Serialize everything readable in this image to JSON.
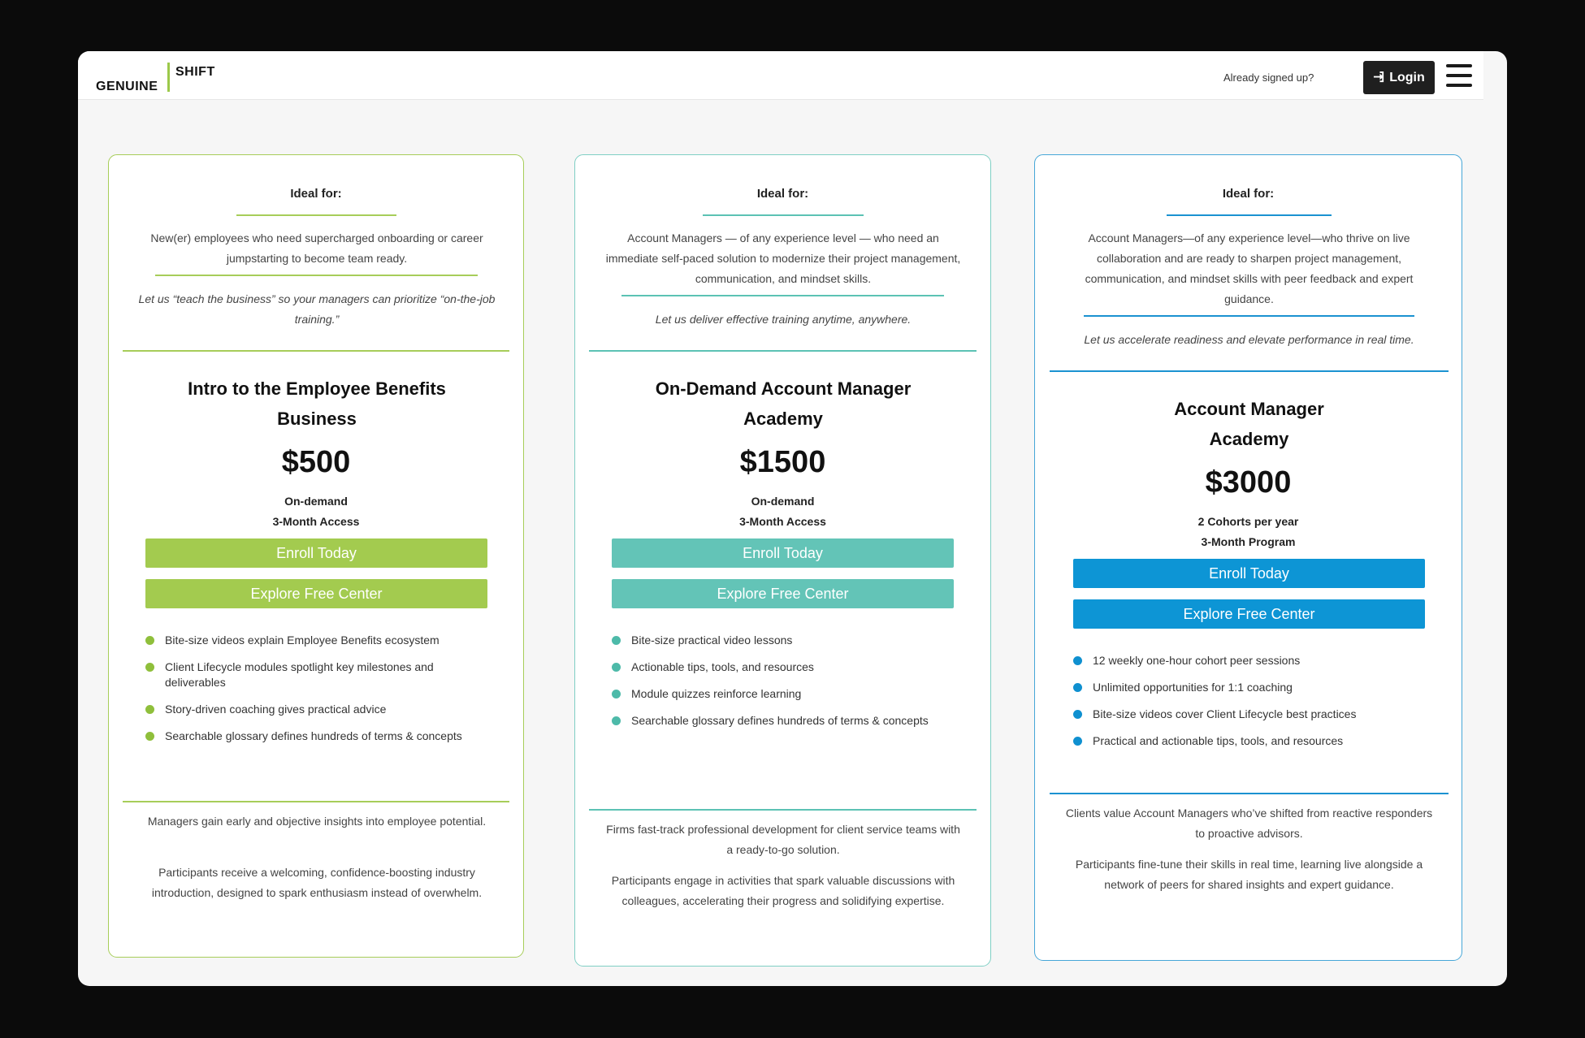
{
  "header": {
    "logo_left": "GENUINE",
    "logo_right": "SHIFT",
    "signed_up_text": "Already signed up?",
    "login_label": "Login",
    "login_icon": "sign-in-icon",
    "menu_icon": "hamburger-menu-icon"
  },
  "colors": {
    "green": "#a3cb4f",
    "teal": "#63c4b7",
    "blue": "#0d95d5",
    "dark": "#1f1f1f"
  },
  "plans": [
    {
      "ideal_label": "Ideal for:",
      "ideal_desc": "New(er) employees who need supercharged onboarding or career jumpstarting to become team ready.",
      "tagline": "Let us “teach the business” so your managers can prioritize “on-the-job training.”",
      "title": "Intro to the Employee Benefits Business",
      "price": "$500",
      "meta_1": "On-demand",
      "meta_2": "3-Month Access",
      "enroll_label": "Enroll Today",
      "explore_label": "Explore Free Center",
      "features": [
        "Bite-size videos explain Employee Benefits ecosystem",
        "Client Lifecycle modules spotlight key milestones and deliverables",
        "Story-driven coaching gives practical advice",
        "Searchable glossary defines hundreds of terms & concepts"
      ],
      "outcome_1": "Managers gain early and objective insights into employee potential.",
      "outcome_2": "Participants receive a welcoming, confidence-boosting industry introduction, designed to spark enthusiasm instead of overwhelm."
    },
    {
      "ideal_label": "Ideal for:",
      "ideal_desc": "Account Managers — of any experience level — who need an immediate self-paced solution to modernize their project management, communication, and mindset skills.",
      "tagline": "Let us deliver effective training anytime, anywhere.",
      "title": "On-Demand Account Manager Academy",
      "price": "$1500",
      "meta_1": "On-demand",
      "meta_2": "3-Month Access",
      "enroll_label": "Enroll Today",
      "explore_label": "Explore Free Center",
      "features": [
        "Bite-size practical video lessons",
        "Actionable tips, tools, and resources",
        "Module quizzes reinforce learning",
        "Searchable glossary defines hundreds of terms & concepts"
      ],
      "outcome_1": "Firms fast-track professional development for client service teams with a ready-to-go solution.",
      "outcome_2": "Participants engage in activities that spark valuable discussions with colleagues, accelerating their progress and solidifying expertise."
    },
    {
      "ideal_label": "Ideal for:",
      "ideal_desc": "Account Managers—of any experience level—who thrive on live collaboration and are ready to sharpen project management, communication, and mindset skills with peer feedback and expert guidance.",
      "tagline": "Let us accelerate readiness and elevate performance in real time.",
      "title": "Account Manager Academy",
      "price": "$3000",
      "meta_1": "2 Cohorts per year",
      "meta_2": "3-Month Program",
      "enroll_label": "Enroll Today",
      "explore_label": "Explore Free Center",
      "features": [
        "12 weekly one-hour cohort peer sessions",
        "Unlimited opportunities for 1:1 coaching",
        "Bite-size videos cover Client Lifecycle best practices",
        "Practical and actionable tips, tools, and resources"
      ],
      "outcome_1": "Clients value Account Managers who’ve shifted from reactive responders to proactive advisors.",
      "outcome_2": "Participants fine-tune their skills in real time, learning live alongside a network of peers for shared insights and expert guidance."
    }
  ]
}
